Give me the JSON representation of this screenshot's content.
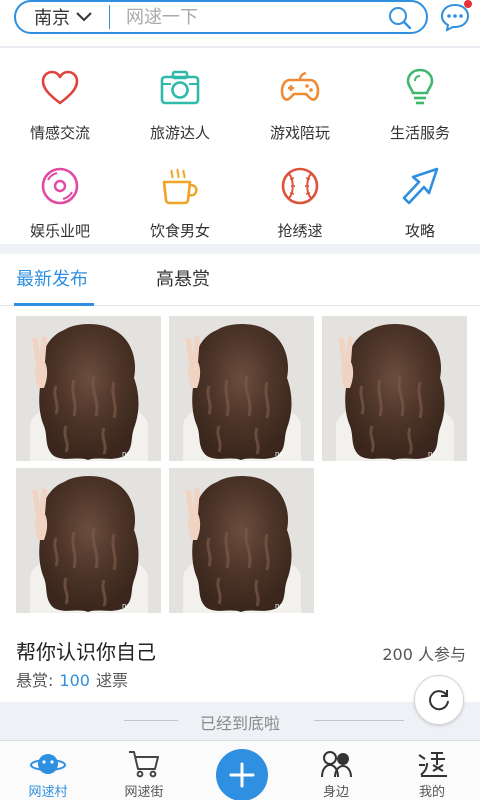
{
  "search": {
    "city": "南京",
    "placeholder": "网逑一下"
  },
  "categories": [
    {
      "label": "情感交流",
      "icon": "heart-icon",
      "color": "#e0413b"
    },
    {
      "label": "旅游达人",
      "icon": "camera-icon",
      "color": "#2fb9a8"
    },
    {
      "label": "游戏陪玩",
      "icon": "gamepad-icon",
      "color": "#f08a34"
    },
    {
      "label": "生活服务",
      "icon": "lightbulb-icon",
      "color": "#3fb86b"
    },
    {
      "label": "娱乐业吧",
      "icon": "music-disc-icon",
      "color": "#e24aa4"
    },
    {
      "label": "饮食男女",
      "icon": "coffee-cup-icon",
      "color": "#f0a424"
    },
    {
      "label": "抢绣逑",
      "icon": "baseball-icon",
      "color": "#e0533b"
    },
    {
      "label": "攻略",
      "icon": "arrow-icon",
      "color": "#2f8fe0"
    }
  ],
  "tabs": [
    {
      "label": "最新发布",
      "active": true
    },
    {
      "label": "高悬赏",
      "active": false
    }
  ],
  "post": {
    "title": "帮你认识你自己",
    "participants": "200 人参与",
    "reward_label": "悬赏:",
    "reward_value": "100",
    "reward_unit": "逑票",
    "photo_count": 5
  },
  "end_text": "已经到底啦",
  "nav": [
    {
      "label": "网逑村",
      "icon": "planet-icon",
      "active": true
    },
    {
      "label": "网逑街",
      "icon": "cart-icon",
      "active": false
    },
    {
      "label": "",
      "icon": "plus-icon",
      "active": false
    },
    {
      "label": "身边",
      "icon": "people-icon",
      "active": false
    },
    {
      "label": "我的",
      "icon": "profile-icon",
      "active": false
    }
  ],
  "colors": {
    "accent": "#2f8fe0",
    "badge": "#e53232",
    "divider": "#eef1f5"
  }
}
